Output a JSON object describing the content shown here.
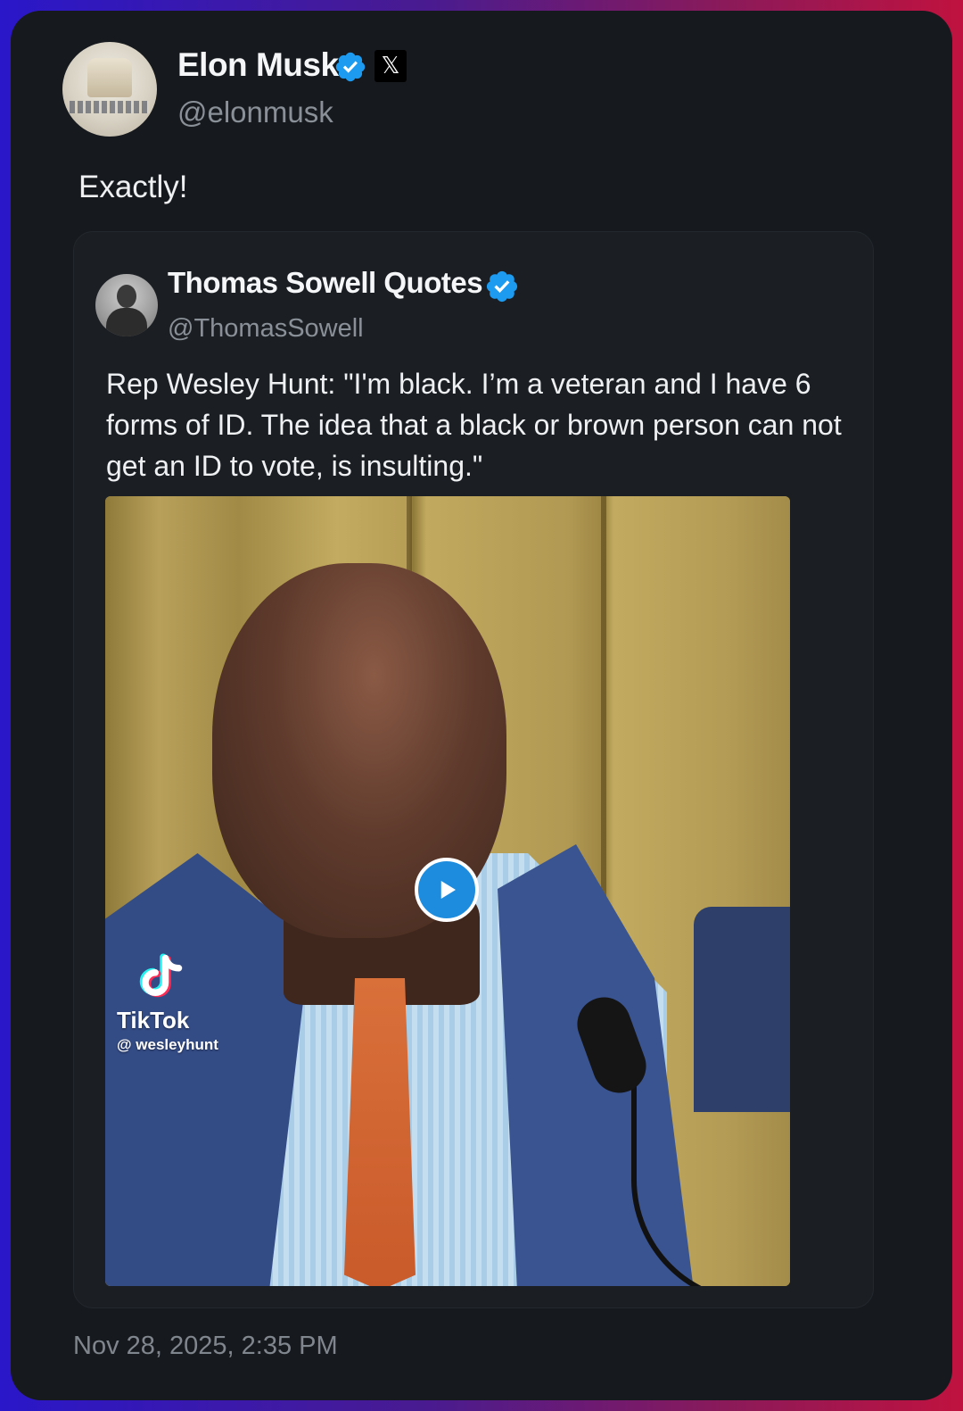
{
  "post": {
    "author_name": "Elon Musk",
    "author_handle": "@elonmusk",
    "text": "Exactly!",
    "timestamp": "Nov 28, 2025, 2:35 PM",
    "affiliate_badge_icon": "x-logo-icon",
    "verified_icon": "verified-badge-icon"
  },
  "quoted": {
    "author_name": "Thomas Sowell Quotes",
    "author_handle": "@ThomasSowell",
    "text": "Rep Wesley Hunt: \"I'm black. I’m a veteran and I have 6 forms of ID. The idea that a black or brown person can not get an ID to vote, is insulting.\"",
    "verified_icon": "verified-badge-icon",
    "media": {
      "type": "video",
      "watermark_brand": "TikTok",
      "watermark_user": "@ wesleyhunt",
      "play_icon": "play-icon"
    }
  },
  "colors": {
    "card_bg": "#16191d",
    "quote_bg": "#1b1f24",
    "verified_blue": "#1d9bf0",
    "muted_text": "#8a9097"
  }
}
